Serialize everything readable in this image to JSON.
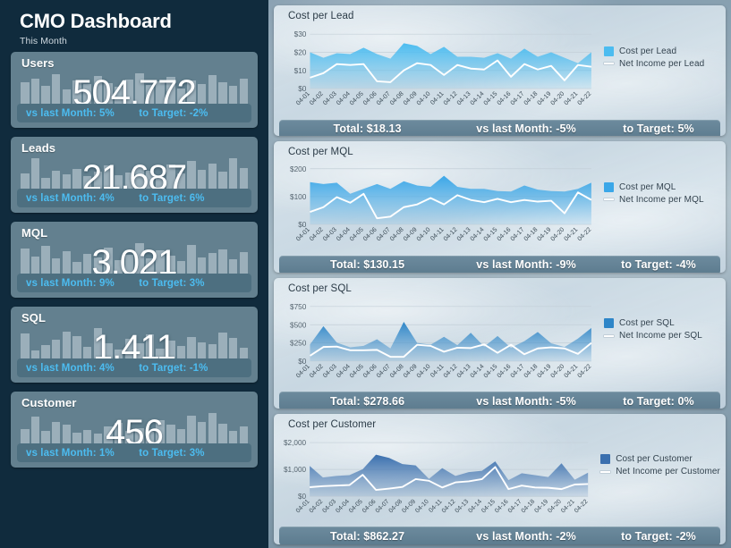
{
  "header": {
    "title": "CMO Dashboard",
    "subtitle": "This Month"
  },
  "colors": {
    "sidebar_bg": "#102b3d",
    "card_bg": "#63808f",
    "card_footer_bg": "#4d6f80",
    "accent_text": "#4cbcf0",
    "chart_footer_bg": "#5c7b8e",
    "area_lead": "#4cbcf0",
    "area_mql": "#3ba7e8",
    "area_sql": "#2e86c8",
    "area_customer": "#3a6fae",
    "line_color": "#ffffff"
  },
  "kpis": [
    {
      "label": "Users",
      "value": "504,772",
      "vs_last_month": "vs last Month: 5%",
      "to_target": "to Target: -2%",
      "spark": [
        62,
        70,
        55,
        78,
        48,
        66,
        58,
        74,
        60,
        52,
        68,
        80,
        56,
        64,
        72,
        50,
        66,
        58,
        76,
        62,
        54,
        70
      ]
    },
    {
      "label": "Leads",
      "value": "21,687",
      "vs_last_month": "vs last Month: 4%",
      "to_target": "to Target: 6%",
      "spark": [
        52,
        86,
        44,
        58,
        50,
        62,
        46,
        56,
        70,
        48,
        54,
        66,
        58,
        44,
        72,
        52,
        80,
        60,
        74,
        56,
        86,
        64
      ]
    },
    {
      "label": "MQL",
      "value": "3,021",
      "vs_last_month": "vs last Month: 9%",
      "to_target": "to Target: 3%",
      "spark": [
        78,
        60,
        84,
        56,
        72,
        48,
        66,
        58,
        80,
        52,
        64,
        90,
        56,
        74,
        62,
        50,
        86,
        58,
        68,
        76,
        54,
        70
      ]
    },
    {
      "label": "SQL",
      "value": "1,411",
      "vs_last_month": "vs last Month: 4%",
      "to_target": "to Target: -1%",
      "spark": [
        82,
        42,
        54,
        68,
        88,
        76,
        50,
        96,
        60,
        44,
        70,
        58,
        80,
        46,
        66,
        52,
        74,
        62,
        56,
        86,
        72,
        48
      ]
    },
    {
      "label": "Customer",
      "value": "456",
      "vs_last_month": "vs last Month: 1%",
      "to_target": "to Target: 3%",
      "spark": [
        48,
        72,
        44,
        62,
        56,
        40,
        46,
        38,
        52,
        60,
        44,
        50,
        42,
        66,
        56,
        48,
        74,
        62,
        80,
        58,
        44,
        52
      ]
    }
  ],
  "chart_data": [
    {
      "type": "area",
      "title": "Cost per Lead",
      "panel_index": 0,
      "x": [
        "04-01",
        "04-02",
        "04-03",
        "04-04",
        "04-05",
        "04-06",
        "04-07",
        "04-08",
        "04-09",
        "04-10",
        "04-11",
        "04-12",
        "04-13",
        "04-14",
        "04-15",
        "04-16",
        "04-17",
        "04-18",
        "04-19",
        "04-20",
        "04-21",
        "04-22"
      ],
      "xlabel": "",
      "ylabel": "",
      "ylim": [
        0,
        33
      ],
      "yticks": [
        0,
        10,
        20,
        30
      ],
      "ytick_labels": [
        "$0",
        "$10",
        "$20",
        "$30"
      ],
      "grid": true,
      "legend_position": "right",
      "series": [
        {
          "name": "Cost per Lead",
          "kind": "area",
          "color": "#4cbcf0",
          "values": [
            20.0,
            17.0,
            19.5,
            19.0,
            22.5,
            19.0,
            16.5,
            25.0,
            23.5,
            19.0,
            23.0,
            17.5,
            17.5,
            17.0,
            19.5,
            16.5,
            22.0,
            17.5,
            20.0,
            17.0,
            14.0,
            20.0
          ]
        },
        {
          "name": "Net Income per Lead",
          "kind": "line",
          "color": "#ffffff",
          "values": [
            6.0,
            8.5,
            13.5,
            13.0,
            13.5,
            4.0,
            3.5,
            10.0,
            14.0,
            13.0,
            7.5,
            13.0,
            11.0,
            10.5,
            15.5,
            6.5,
            13.5,
            10.5,
            12.5,
            4.5,
            13.0,
            12.0
          ]
        }
      ],
      "footer": {
        "total": "Total: $18.13",
        "vs_last_month": "vs last Month: -5%",
        "to_target": "to Target: 5%"
      }
    },
    {
      "type": "area",
      "title": "Cost per MQL",
      "panel_index": 1,
      "x": [
        "04-01",
        "04-02",
        "04-03",
        "04-04",
        "04-05",
        "04-06",
        "04-07",
        "04-08",
        "04-09",
        "04-10",
        "04-11",
        "04-12",
        "04-13",
        "04-14",
        "04-15",
        "04-16",
        "04-17",
        "04-18",
        "04-19",
        "04-20",
        "04-21",
        "04-22"
      ],
      "xlabel": "",
      "ylabel": "",
      "ylim": [
        0,
        215
      ],
      "yticks": [
        0,
        100,
        200
      ],
      "ytick_labels": [
        "$0",
        "$100",
        "$200"
      ],
      "grid": true,
      "legend_position": "right",
      "series": [
        {
          "name": "Cost per MQL",
          "kind": "area",
          "color": "#3ba7e8",
          "values": [
            152,
            145,
            150,
            110,
            128,
            145,
            128,
            155,
            140,
            135,
            175,
            135,
            128,
            128,
            120,
            118,
            140,
            125,
            120,
            118,
            128,
            150
          ]
        },
        {
          "name": "Net Income per MQL",
          "kind": "line",
          "color": "#ffffff",
          "values": [
            45,
            62,
            98,
            78,
            110,
            22,
            28,
            62,
            72,
            95,
            72,
            105,
            88,
            80,
            92,
            80,
            88,
            82,
            85,
            40,
            115,
            88
          ]
        }
      ],
      "footer": {
        "total": "Total: $130.15",
        "vs_last_month": "vs last Month: -9%",
        "to_target": "to Target: -4%"
      }
    },
    {
      "type": "area",
      "title": "Cost per SQL",
      "panel_index": 2,
      "x": [
        "04-01",
        "04-02",
        "04-03",
        "04-04",
        "04-05",
        "04-06",
        "04-07",
        "04-08",
        "04-09",
        "04-10",
        "04-11",
        "04-12",
        "04-13",
        "04-14",
        "04-15",
        "04-16",
        "04-17",
        "04-18",
        "04-19",
        "04-20",
        "04-21",
        "04-22"
      ],
      "xlabel": "",
      "ylabel": "",
      "ylim": [
        0,
        820
      ],
      "yticks": [
        0,
        250,
        500,
        750
      ],
      "ytick_labels": [
        "$0",
        "$250",
        "$500",
        "$750"
      ],
      "grid": true,
      "legend_position": "right",
      "series": [
        {
          "name": "Cost per SQL",
          "kind": "area",
          "color": "#2e86c8",
          "values": [
            230,
            480,
            255,
            190,
            210,
            300,
            175,
            540,
            250,
            225,
            335,
            220,
            390,
            200,
            345,
            185,
            275,
            400,
            245,
            195,
            310,
            455
          ]
        },
        {
          "name": "Net Income per SQL",
          "kind": "line",
          "color": "#ffffff",
          "values": [
            75,
            195,
            200,
            150,
            150,
            155,
            60,
            60,
            225,
            210,
            130,
            185,
            180,
            230,
            115,
            225,
            95,
            175,
            190,
            175,
            100,
            250
          ]
        }
      ],
      "footer": {
        "total": "Total: $278.66",
        "vs_last_month": "vs last Month: -5%",
        "to_target": "to Target: 0%"
      }
    },
    {
      "type": "area",
      "title": "Cost per Customer",
      "panel_index": 3,
      "x": [
        "04-01",
        "04-02",
        "04-03",
        "04-04",
        "04-05",
        "04-06",
        "04-07",
        "04-08",
        "04-09",
        "04-10",
        "04-11",
        "04-12",
        "04-13",
        "04-14",
        "04-15",
        "04-16",
        "04-17",
        "04-18",
        "04-19",
        "04-20",
        "04-21",
        "04-22"
      ],
      "xlabel": "",
      "ylabel": "",
      "ylim": [
        0,
        2200
      ],
      "yticks": [
        0,
        1000,
        2000
      ],
      "ytick_labels": [
        "$0",
        "$1,000",
        "$2,000"
      ],
      "grid": true,
      "legend_position": "right",
      "series": [
        {
          "name": "Cost per Customer",
          "kind": "area",
          "color": "#3a6fae",
          "values": [
            1130,
            700,
            760,
            790,
            1010,
            1550,
            1430,
            1200,
            1150,
            650,
            1050,
            760,
            900,
            950,
            1300,
            600,
            860,
            790,
            720,
            1230,
            620,
            880
          ]
        },
        {
          "name": "Net Income per Customer",
          "kind": "line",
          "color": "#ffffff",
          "values": [
            340,
            380,
            400,
            420,
            800,
            240,
            290,
            350,
            640,
            580,
            330,
            520,
            560,
            640,
            1090,
            270,
            400,
            330,
            320,
            270,
            440,
            460
          ]
        }
      ],
      "footer": {
        "total": "Total: $862.27",
        "vs_last_month": "vs last Month: -2%",
        "to_target": "to Target: -2%"
      }
    }
  ]
}
